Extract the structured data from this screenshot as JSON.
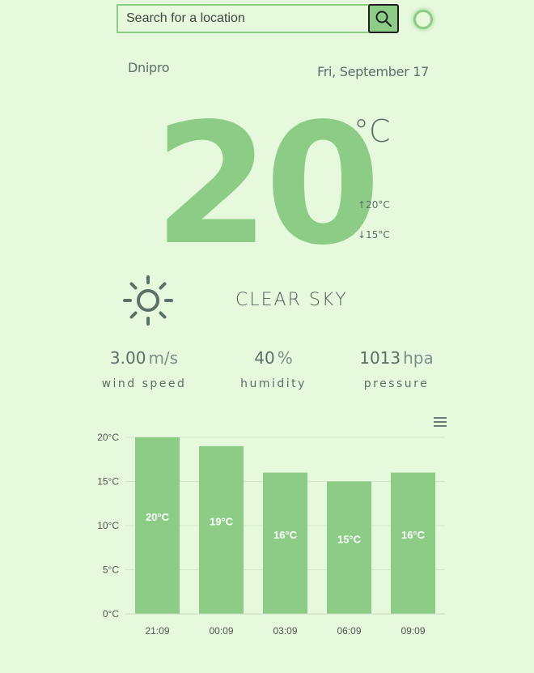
{
  "search": {
    "placeholder": "Search for a location",
    "value": ""
  },
  "location": {
    "city": "Dnipro",
    "date": "Fri, September 17"
  },
  "current": {
    "temp": "20",
    "unit": "°C",
    "high": "↑20°C",
    "low": "↓15°C",
    "condition": "CLEAR SKY",
    "icon": "sun-icon"
  },
  "stats": {
    "wind": {
      "value": "3.00",
      "unit": "m/s",
      "label": "wind speed"
    },
    "humidity": {
      "value": "40",
      "unit": "%",
      "label": "humidity"
    },
    "pressure": {
      "value": "1013",
      "unit": "hpa",
      "label": "pressure"
    }
  },
  "colors": {
    "background": "#e6f9dc",
    "accent": "#8ccc86",
    "text": "#5b6f6b"
  },
  "chart_data": {
    "type": "bar",
    "categories": [
      "21:09",
      "00:09",
      "03:09",
      "06:09",
      "09:09"
    ],
    "values": [
      20,
      19,
      16,
      15,
      16
    ],
    "value_labels": [
      "20°C",
      "19°C",
      "16°C",
      "15°C",
      "16°C"
    ],
    "y_ticks": [
      "0°C",
      "5°C",
      "10°C",
      "15°C",
      "20°C"
    ],
    "ylim": [
      0,
      20
    ],
    "grid": true,
    "bar_color": "#8ccc86",
    "menu_icon": "hamburger-menu-icon"
  }
}
